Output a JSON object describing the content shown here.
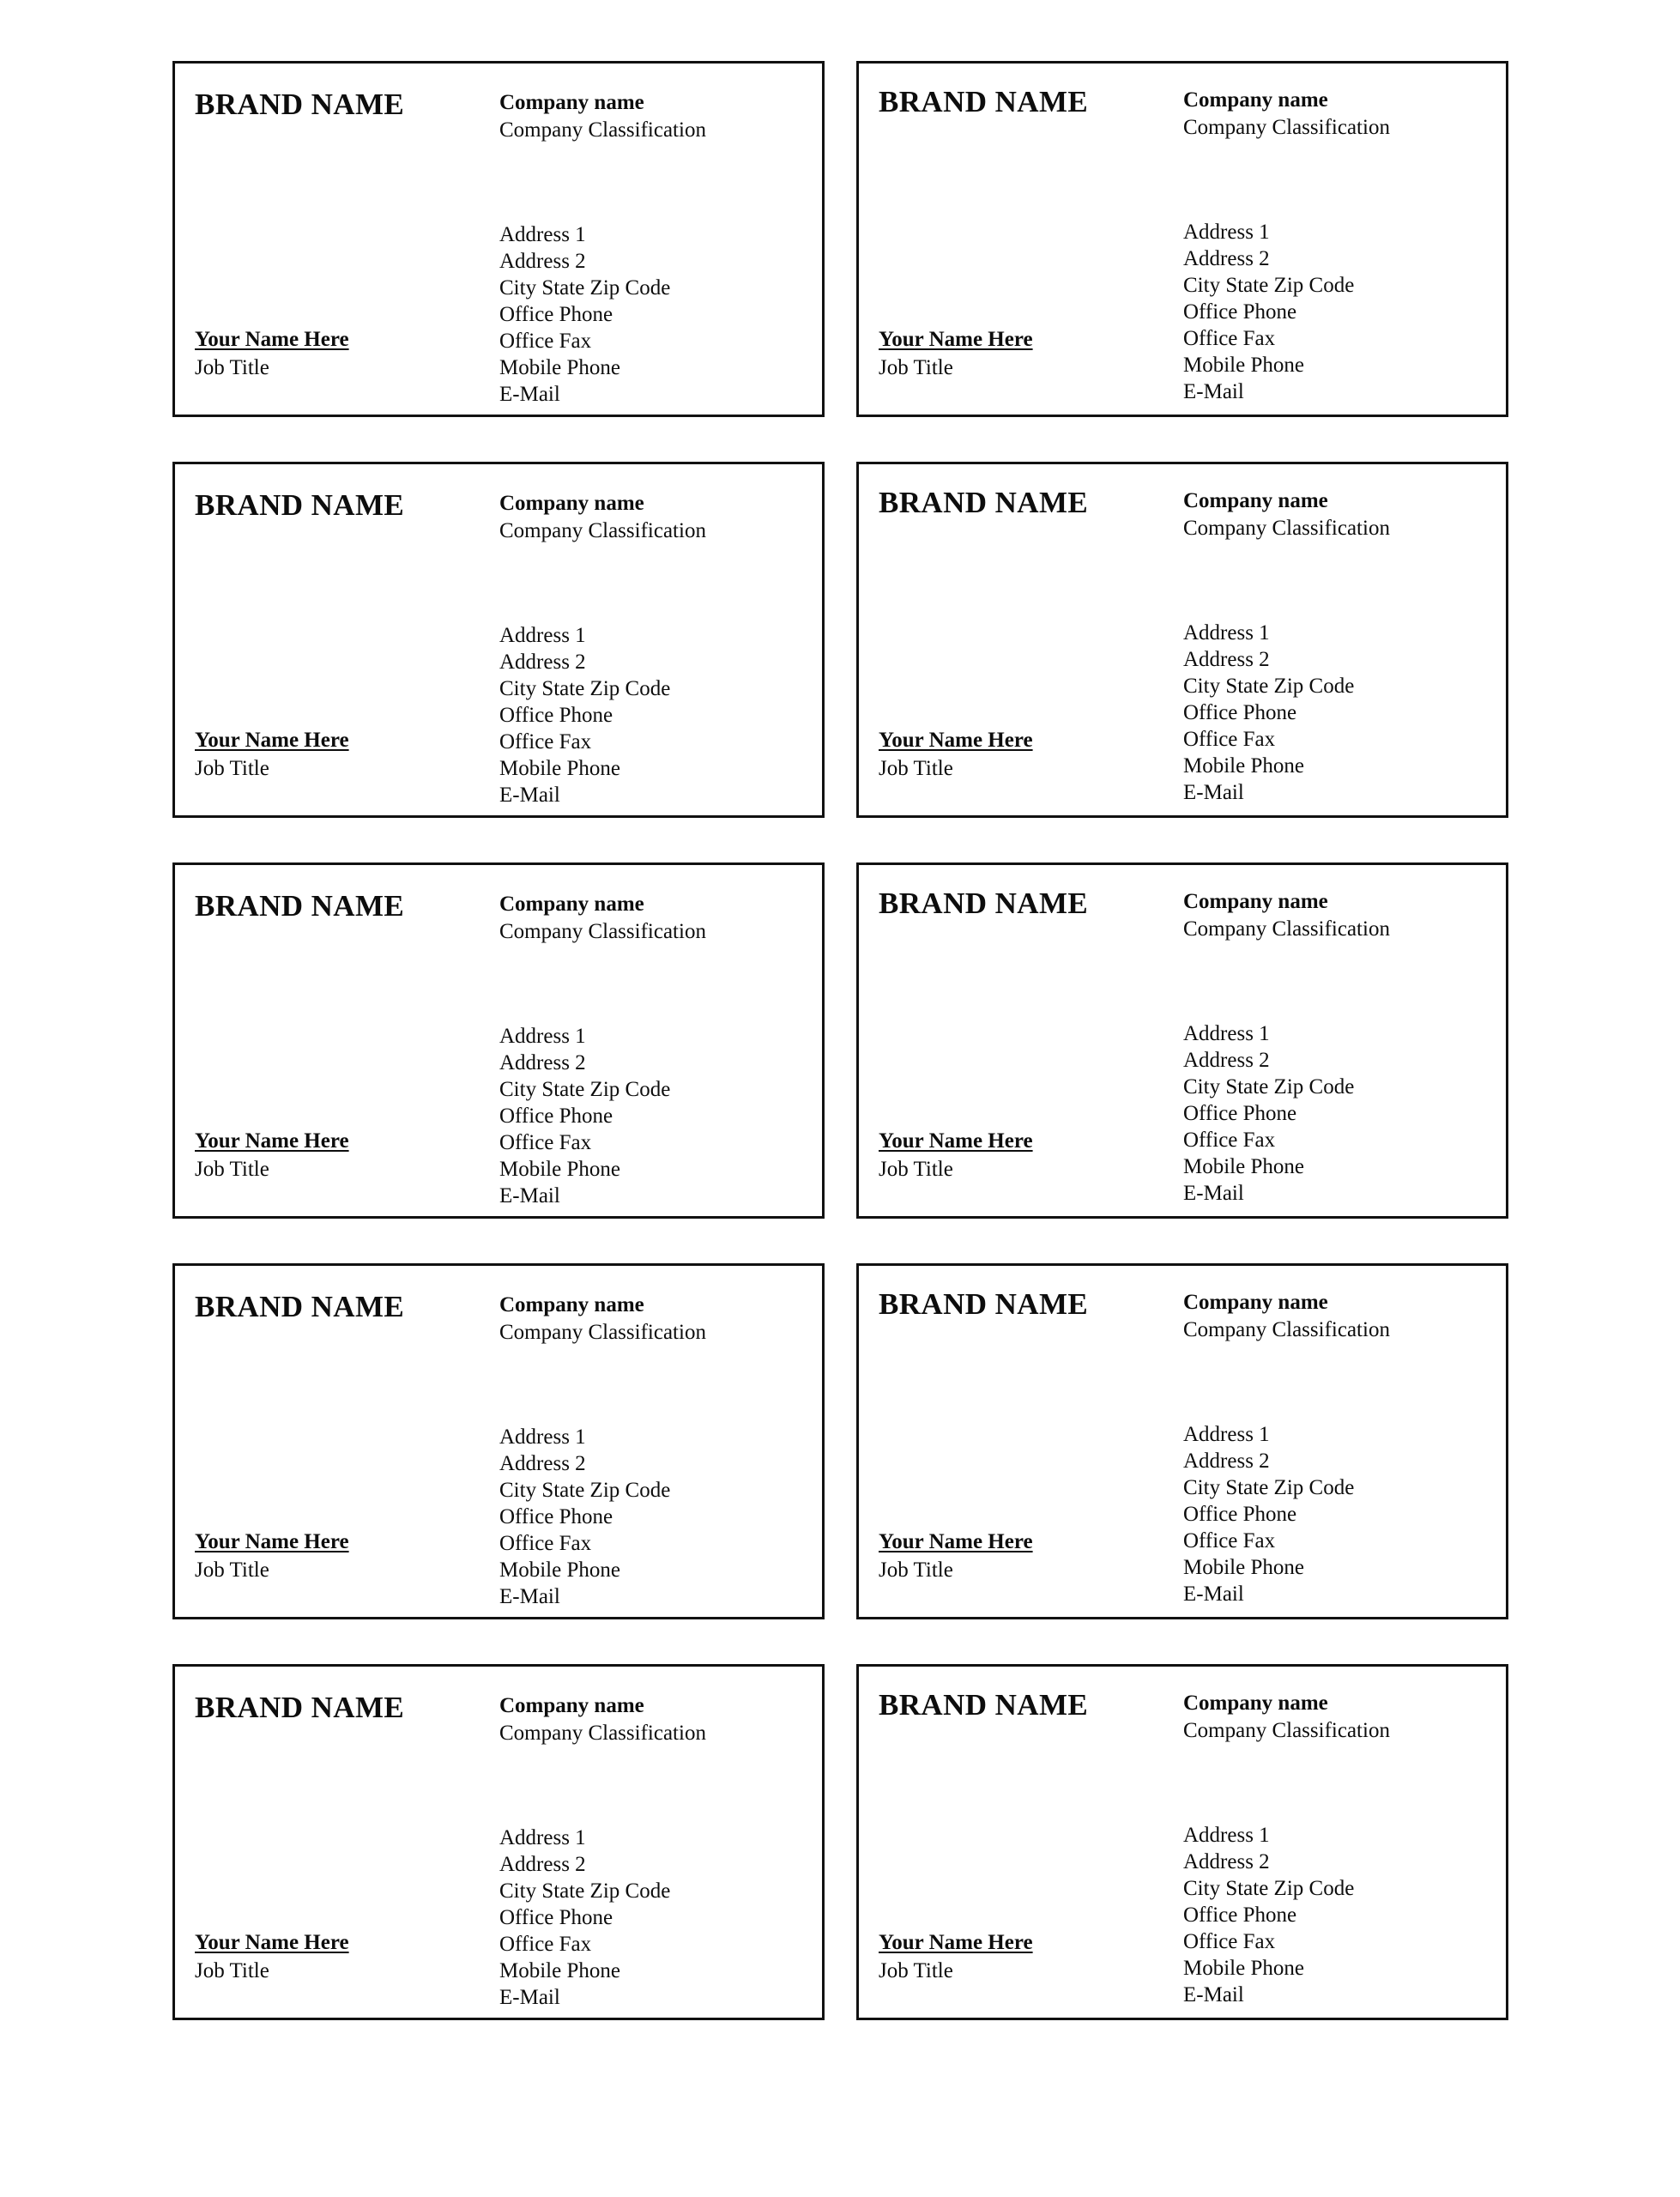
{
  "page": {
    "background_color": "#ffffff",
    "border_color": "#111111",
    "text_color": "#0d0d0d",
    "card_count": 10,
    "columns": 2,
    "rows": 5
  },
  "card": {
    "brand_name": "BRAND NAME",
    "person_name": "Your Name Here",
    "person_title": "Job Title",
    "company_name": "Company name",
    "company_classification": "Company Classification",
    "contact_lines": [
      "Address 1",
      "Address 2",
      "City State Zip Code",
      "Office Phone",
      "Office Fax",
      "Mobile Phone",
      "E-Mail"
    ]
  }
}
